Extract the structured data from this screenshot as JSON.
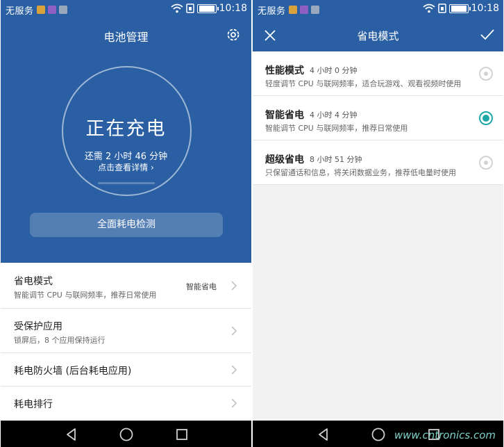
{
  "colors": {
    "header": "#2a5fa3",
    "accent": "#1fa6a6",
    "navbar": "#000000"
  },
  "status_bar": {
    "carrier": "无服务",
    "time": "10:18"
  },
  "battery_screen": {
    "title": "电池管理",
    "settings_icon": "gear-icon",
    "ring": {
      "status": "正在充电",
      "remaining": "还需 2 小时 46 分钟",
      "details_link": "点击查看详情"
    },
    "scan_button": "全面耗电检测",
    "items": [
      {
        "title": "省电模式",
        "desc": "智能调节 CPU 与联网频率，推荐日常使用",
        "value": "智能省电"
      },
      {
        "title": "受保护应用",
        "desc": "锁屏后，8 个应用保持运行"
      },
      {
        "title": "耗电防火墙 (后台耗电应用)"
      },
      {
        "title": "耗电排行"
      }
    ]
  },
  "mode_screen": {
    "title": "省电模式",
    "modes": [
      {
        "name": "性能模式",
        "time": "4 小时 0 分钟",
        "desc": "轻度调节 CPU 与联网频率，适合玩游戏、观看视频时使用",
        "selected": false
      },
      {
        "name": "智能省电",
        "time": "4 小时 4 分钟",
        "desc": "智能调节 CPU 与联网频率，推荐日常使用",
        "selected": true
      },
      {
        "name": "超级省电",
        "time": "8 小时 51 分钟",
        "desc": "只保留通话和信息，将关闭数据业务，推荐低电量时使用",
        "selected": false
      }
    ]
  },
  "watermark": "www.cntronics.com"
}
